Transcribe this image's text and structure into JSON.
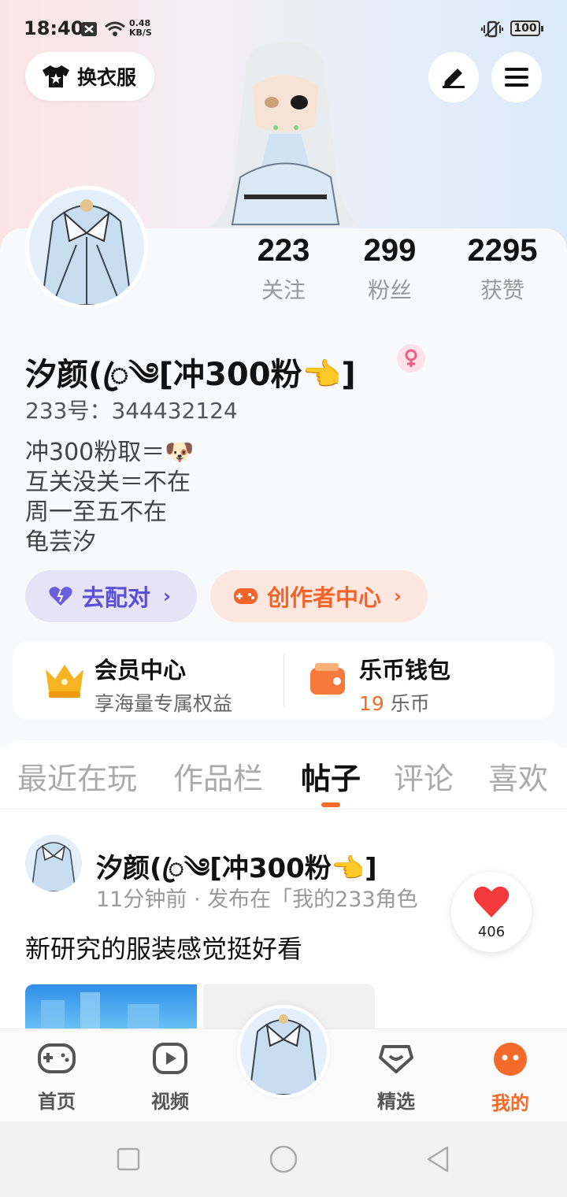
{
  "status_bar": {
    "time": "18:40",
    "net_speed_value": "0.48",
    "net_speed_unit": "KB/S",
    "battery": "100"
  },
  "header": {
    "outfit_button_label": "换衣服",
    "edit_icon": "pen-icon",
    "menu_icon": "hamburger-icon"
  },
  "profile": {
    "stats": [
      {
        "value": "223",
        "label": "关注"
      },
      {
        "value": "299",
        "label": "粉丝"
      },
      {
        "value": "2295",
        "label": "获赞"
      }
    ],
    "username": "汐颜(ꦿ༄[冲300粉👈]",
    "gender_icon": "female-icon",
    "uid_line": "233号：344432124",
    "bio": [
      "冲300粉取＝🐶",
      "互关没关＝不在",
      "周一至五不在",
      "龟芸汐"
    ]
  },
  "actions": {
    "pair_label": "去配对",
    "creator_label": "创作者中心"
  },
  "member": {
    "vip_title": "会员中心",
    "vip_sub": "享海量专属权益",
    "wallet_title": "乐币钱包",
    "wallet_amount": "19",
    "wallet_unit": "乐币"
  },
  "tabs": [
    "最近在玩",
    "作品栏",
    "帖子",
    "评论",
    "喜欢"
  ],
  "active_tab": "帖子",
  "post": {
    "author": "汐颜(ꦿ༄[冲300粉👈]",
    "meta": "11分钟前 · 发布在「我的233角色",
    "text": "新研究的服装感觉挺好看",
    "likes": "406"
  },
  "bottom_nav": [
    {
      "label": "首页",
      "icon": "gamepad-icon"
    },
    {
      "label": "视频",
      "icon": "play-icon"
    },
    {
      "label": "精选",
      "icon": "heart-box-icon"
    },
    {
      "label": "我的",
      "icon": "face-icon"
    }
  ],
  "colors": {
    "accent": "#f46a2a",
    "pair_purple": "#5b4fd8",
    "creator_orange": "#f3632a"
  }
}
